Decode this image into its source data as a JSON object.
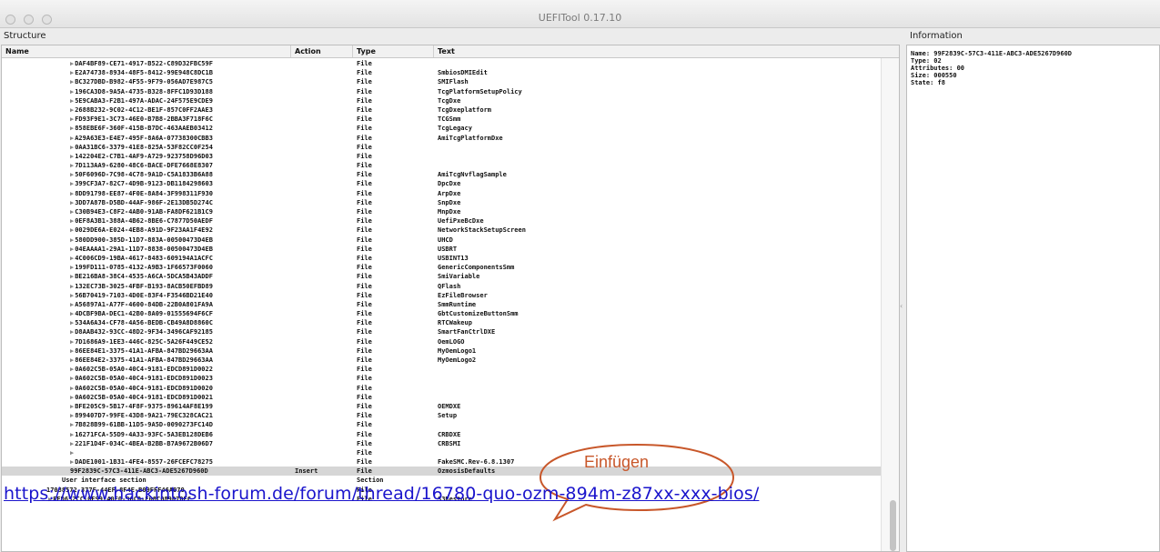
{
  "window": {
    "title": "UEFITool 0.17.10"
  },
  "structure_label": "Structure",
  "information_label": "Information",
  "columns": {
    "name": "Name",
    "action": "Action",
    "type": "Type",
    "text": "Text"
  },
  "rows": [
    {
      "name": "DAF4BF89-CE71-4917-B522-C89D32FBC59F",
      "action": "",
      "type": "File",
      "text": "",
      "indent": 1,
      "arrow": true
    },
    {
      "name": "E2A74738-8934-48F5-8412-99E948C8DC1B",
      "action": "",
      "type": "File",
      "text": "SmbiosDMIEdit",
      "indent": 1,
      "arrow": true
    },
    {
      "name": "BC327DBD-B982-4F55-9F79-056AD7E987C5",
      "action": "",
      "type": "File",
      "text": "SMIFlash",
      "indent": 1,
      "arrow": true
    },
    {
      "name": "196CA3D8-9A5A-4735-B328-8FFC1D93D188",
      "action": "",
      "type": "File",
      "text": "TcgPlatformSetupPolicy",
      "indent": 1,
      "arrow": true
    },
    {
      "name": "5E9CABA3-F2B1-497A-ADAC-24F575E9CDE9",
      "action": "",
      "type": "File",
      "text": "TcgDxe",
      "indent": 1,
      "arrow": true
    },
    {
      "name": "2688B232-9C02-4C12-BE1F-857C0FF2AAE3",
      "action": "",
      "type": "File",
      "text": "TcgDxeplatform",
      "indent": 1,
      "arrow": true
    },
    {
      "name": "FD93F9E1-3C73-46E0-B7B8-2BBA3F718F6C",
      "action": "",
      "type": "File",
      "text": "TCGSmm",
      "indent": 1,
      "arrow": true
    },
    {
      "name": "858EBE6F-360F-415B-B7DC-463AAEB03412",
      "action": "",
      "type": "File",
      "text": "TcgLegacy",
      "indent": 1,
      "arrow": true
    },
    {
      "name": "A29A63E3-E4E7-495F-8A6A-07738300CBB3",
      "action": "",
      "type": "File",
      "text": "AmiTcgPlatformDxe",
      "indent": 1,
      "arrow": true
    },
    {
      "name": "0AA31BC6-3379-41E8-825A-53F82CC0F254",
      "action": "",
      "type": "File",
      "text": "",
      "indent": 1,
      "arrow": true
    },
    {
      "name": "142204E2-C7B1-4AF9-A729-923758D96D03",
      "action": "",
      "type": "File",
      "text": "",
      "indent": 1,
      "arrow": true
    },
    {
      "name": "7D113AA9-6280-48C6-BACE-DFE7668E8307",
      "action": "",
      "type": "File",
      "text": "",
      "indent": 1,
      "arrow": true
    },
    {
      "name": "50F6096D-7C98-4C78-9A1D-C5A1833B6A88",
      "action": "",
      "type": "File",
      "text": "AmiTcgNvflagSample",
      "indent": 1,
      "arrow": true
    },
    {
      "name": "399CF3A7-82C7-4D9B-9123-DB1184298603",
      "action": "",
      "type": "File",
      "text": "DpcDxe",
      "indent": 1,
      "arrow": true
    },
    {
      "name": "8DD91798-EE87-4F0E-8A84-3F998311F930",
      "action": "",
      "type": "File",
      "text": "ArpDxe",
      "indent": 1,
      "arrow": true
    },
    {
      "name": "3DD7A87B-D5BD-44AF-986F-2E13DB5D274C",
      "action": "",
      "type": "File",
      "text": "SnpDxe",
      "indent": 1,
      "arrow": true
    },
    {
      "name": "C30B94E3-C8F2-4AB0-91AB-FA8DF621B1C9",
      "action": "",
      "type": "File",
      "text": "MnpDxe",
      "indent": 1,
      "arrow": true
    },
    {
      "name": "0EF8A3B1-388A-4B62-8BE6-C7877D50AEDF",
      "action": "",
      "type": "File",
      "text": "UefiPxeBcDxe",
      "indent": 1,
      "arrow": true
    },
    {
      "name": "0029DE6A-E024-4EB8-A91D-9F23AA1F4E92",
      "action": "",
      "type": "File",
      "text": "NetworkStackSetupScreen",
      "indent": 1,
      "arrow": true
    },
    {
      "name": "580DD900-385D-11D7-883A-00500473D4EB",
      "action": "",
      "type": "File",
      "text": "UHCD",
      "indent": 1,
      "arrow": true
    },
    {
      "name": "04EAAAA1-29A1-11D7-8838-00500473D4EB",
      "action": "",
      "type": "File",
      "text": "USBRT",
      "indent": 1,
      "arrow": true
    },
    {
      "name": "4C006CD9-19BA-4617-8483-609194A1ACFC",
      "action": "",
      "type": "File",
      "text": "USBINT13",
      "indent": 1,
      "arrow": true
    },
    {
      "name": "199FD111-0785-4132-A9B3-1F66573F0060",
      "action": "",
      "type": "File",
      "text": "GenericComponentsSmm",
      "indent": 1,
      "arrow": true
    },
    {
      "name": "BE216BA8-38C4-4535-A6CA-5DCA5B43ADDF",
      "action": "",
      "type": "File",
      "text": "SmiVariable",
      "indent": 1,
      "arrow": true
    },
    {
      "name": "132EC73B-3025-4FBF-B193-8ACB50EFBD89",
      "action": "",
      "type": "File",
      "text": "QFlash",
      "indent": 1,
      "arrow": true
    },
    {
      "name": "56B70419-7103-4D0E-83F4-F3546BD21E40",
      "action": "",
      "type": "File",
      "text": "EzFileBrowser",
      "indent": 1,
      "arrow": true
    },
    {
      "name": "A56897A1-A77F-4600-84DB-22B0A801FA9A",
      "action": "",
      "type": "File",
      "text": "SmmRuntime",
      "indent": 1,
      "arrow": true
    },
    {
      "name": "4DCBF9BA-DEC1-42B0-8A09-01555694F6CF",
      "action": "",
      "type": "File",
      "text": "GbtCustomizeButtonSmm",
      "indent": 1,
      "arrow": true
    },
    {
      "name": "534A6A34-CF78-4A56-BEDB-CB49A8D8860C",
      "action": "",
      "type": "File",
      "text": "RTCWakeup",
      "indent": 1,
      "arrow": true
    },
    {
      "name": "D8AAB432-93CC-48D2-9F34-3496CAF92185",
      "action": "",
      "type": "File",
      "text": "SmartFanCtrlDXE",
      "indent": 1,
      "arrow": true
    },
    {
      "name": "7D1686A9-1EE3-446C-825C-5A26F449CE52",
      "action": "",
      "type": "File",
      "text": "OemLOGO",
      "indent": 1,
      "arrow": true
    },
    {
      "name": "86EE84E1-3375-41A1-AFBA-847BD29663AA",
      "action": "",
      "type": "File",
      "text": "MyOemLogo1",
      "indent": 1,
      "arrow": true
    },
    {
      "name": "86EE84E2-3375-41A1-AFBA-847BD29663AA",
      "action": "",
      "type": "File",
      "text": "MyOemLogo2",
      "indent": 1,
      "arrow": true
    },
    {
      "name": "0A602C5B-05A0-40C4-9181-EDCD891D0022",
      "action": "",
      "type": "File",
      "text": "",
      "indent": 1,
      "arrow": true
    },
    {
      "name": "0A602C5B-05A0-40C4-9181-EDCD891D0023",
      "action": "",
      "type": "File",
      "text": "",
      "indent": 1,
      "arrow": true
    },
    {
      "name": "0A602C5B-05A0-40C4-9181-EDCD891D0020",
      "action": "",
      "type": "File",
      "text": "",
      "indent": 1,
      "arrow": true
    },
    {
      "name": "0A602C5B-05A0-40C4-9181-EDCD891D0021",
      "action": "",
      "type": "File",
      "text": "",
      "indent": 1,
      "arrow": true
    },
    {
      "name": "BFE205C9-5B17-4F8F-9375-89614AF8E199",
      "action": "",
      "type": "File",
      "text": "OEMDXE",
      "indent": 1,
      "arrow": true
    },
    {
      "name": "899407D7-99FE-43D8-9A21-79EC328CAC21",
      "action": "",
      "type": "File",
      "text": "Setup",
      "indent": 1,
      "arrow": true
    },
    {
      "name": "7B828B99-61BB-11D5-9A5D-0090273FC14D",
      "action": "",
      "type": "File",
      "text": "",
      "indent": 1,
      "arrow": true
    },
    {
      "name": "16271FCA-55D9-4A33-93FC-5A3EB128DEB6",
      "action": "",
      "type": "File",
      "text": "CRBDXE",
      "indent": 1,
      "arrow": true
    },
    {
      "name": "221F1D4F-034C-4BEA-B2BB-B7A9672B06D7",
      "action": "",
      "type": "File",
      "text": "CRBSMI",
      "indent": 1,
      "arrow": true
    },
    {
      "name": "",
      "action": "",
      "type": "File",
      "text": "",
      "indent": 1,
      "arrow": true
    },
    {
      "name": "DADE1001-1B31-4FE4-8557-26FCEFC78275",
      "action": "",
      "type": "File",
      "text": "FakeSMC.Rev-6.8.1307",
      "indent": 1,
      "arrow": true
    },
    {
      "name": "99F2839C-57C3-411E-ABC3-ADE5267D960D",
      "action": "Insert",
      "type": "File",
      "text": "OzmosisDefaults",
      "indent": 1,
      "arrow": false,
      "selected": true
    },
    {
      "name": "User interface section",
      "action": "",
      "type": "Section",
      "text": "",
      "indent": 2,
      "arrow": false
    },
    {
      "name": "17088572-377F-44EF-8F4E-B09FFF46A070",
      "action": "",
      "type": "File",
      "text": "",
      "indent": 3,
      "arrow": false
    },
    {
      "name": "EFD652CC-0E99-40F0-96C0-E08C089070FC",
      "action": "",
      "type": "File",
      "text": "S3Restore",
      "indent": 4,
      "arrow": true
    }
  ],
  "information": {
    "lines": [
      "Name: 99F2839C-57C3-411E-ABC3-ADE5267D960D",
      "Type: 02",
      "Attributes: 00",
      "Size: 000550",
      "State: f8"
    ]
  },
  "annotation": {
    "callout_text": "Einfügen",
    "overlay_url": "https://www.hackintosh-forum.de/forum/thread/16780-quo-ozm-894m-z87xx-xxx-bios/",
    "callout_color": "#c8572a",
    "url_color": "#1a14cc"
  },
  "colors": {
    "selected_row": "#d6d6d6",
    "header_bg": "#f1f1f1"
  }
}
